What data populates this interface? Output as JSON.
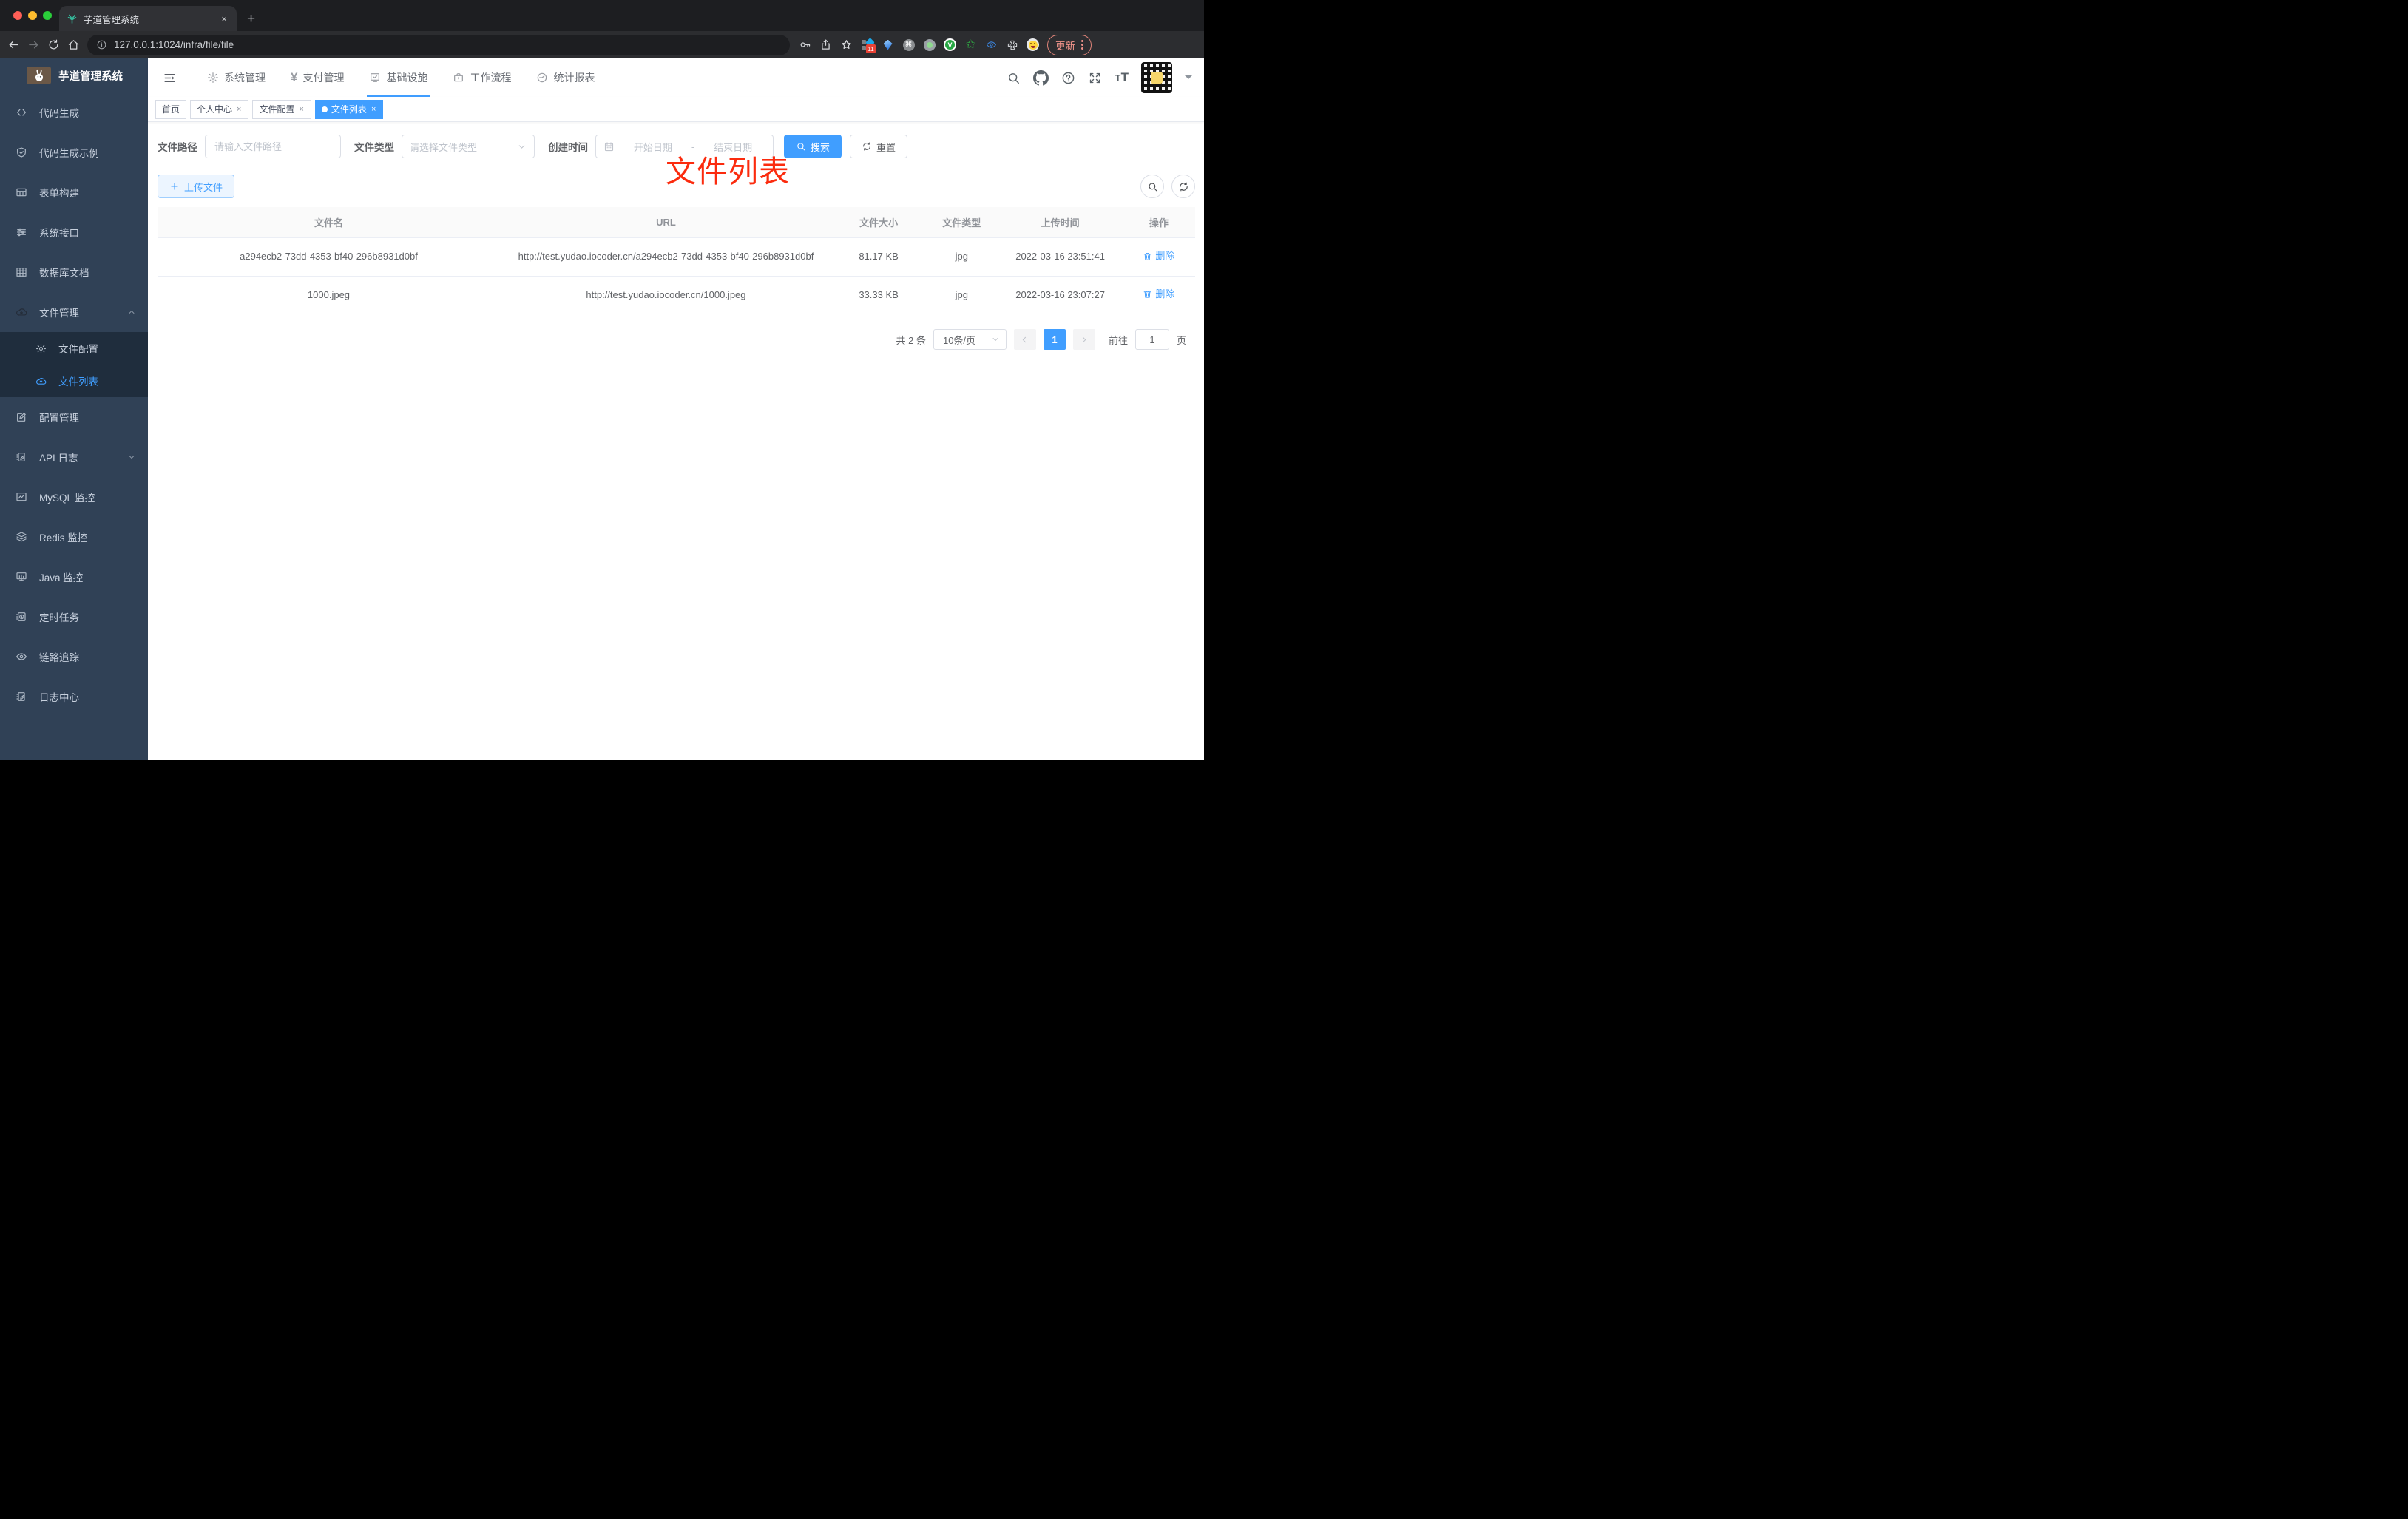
{
  "browser": {
    "tab_title": "芋道管理系统",
    "close_tab": "×",
    "new_tab": "+",
    "url": "127.0.0.1:1024/infra/file/file",
    "extension_badge": "11",
    "v_letter": "V",
    "cmd_glyph": "⌘",
    "star_glyph": "✩",
    "update_label": "更新"
  },
  "sidebar": {
    "title": "芋道管理系统",
    "items": [
      {
        "label": "代码生成",
        "icon": "code-icon"
      },
      {
        "label": "代码生成示例",
        "icon": "shield-icon"
      },
      {
        "label": "表单构建",
        "icon": "form-icon"
      },
      {
        "label": "系统接口",
        "icon": "sliders-icon"
      },
      {
        "label": "数据库文档",
        "icon": "grid-icon"
      },
      {
        "label": "文件管理",
        "icon": "cloud-download-icon",
        "state": "expanded"
      },
      {
        "label": "配置管理",
        "icon": "edit-icon"
      },
      {
        "label": "API 日志",
        "icon": "log-pen-icon",
        "state": "collapsed"
      },
      {
        "label": "MySQL 监控",
        "icon": "chart-icon"
      },
      {
        "label": "Redis 监控",
        "icon": "layers-icon"
      },
      {
        "label": "Java 监控",
        "icon": "monitor-icon"
      },
      {
        "label": "定时任务",
        "icon": "timer-icon"
      },
      {
        "label": "链路追踪",
        "icon": "eye-icon"
      },
      {
        "label": "日志中心",
        "icon": "log-pen-icon"
      }
    ],
    "submenu": [
      {
        "label": "文件配置",
        "icon": "gear-icon"
      },
      {
        "label": "文件列表",
        "icon": "cloud-upload-icon",
        "active": true
      }
    ]
  },
  "topnav": {
    "yen_glyph": "¥",
    "items": [
      {
        "label": "系统管理",
        "icon": "gear-icon"
      },
      {
        "label": "支付管理",
        "icon": "yen-icon"
      },
      {
        "label": "基础设施",
        "icon": "infra-icon",
        "active": true
      },
      {
        "label": "工作流程",
        "icon": "briefcase-icon"
      },
      {
        "label": "统计报表",
        "icon": "dashboard-icon"
      }
    ],
    "font_size_glyph": "тT"
  },
  "tags": [
    {
      "label": "首页",
      "closable": false
    },
    {
      "label": "个人中心",
      "closable": true
    },
    {
      "label": "文件配置",
      "closable": true
    },
    {
      "label": "文件列表",
      "closable": true,
      "active": true
    }
  ],
  "tag_close_glyph": "×",
  "annotation": "文件列表",
  "filters": {
    "path_label": "文件路径",
    "path_placeholder": "请输入文件路径",
    "type_label": "文件类型",
    "type_placeholder": "请选择文件类型",
    "date_label": "创建时间",
    "date_start_placeholder": "开始日期",
    "date_separator": "-",
    "date_end_placeholder": "结束日期",
    "search_label": "搜索",
    "reset_label": "重置"
  },
  "toolbar": {
    "upload_label": "上传文件"
  },
  "table": {
    "columns": [
      "文件名",
      "URL",
      "文件大小",
      "文件类型",
      "上传时间",
      "操作"
    ],
    "rows": [
      {
        "name": "a294ecb2-73dd-4353-bf40-296b8931d0bf",
        "url": "http://test.yudao.iocoder.cn/a294ecb2-73dd-4353-bf40-296b8931d0bf",
        "size": "81.17 KB",
        "type": "jpg",
        "time": "2022-03-16 23:51:41",
        "action": "删除"
      },
      {
        "name": "1000.jpeg",
        "url": "http://test.yudao.iocoder.cn/1000.jpeg",
        "size": "33.33 KB",
        "type": "jpg",
        "time": "2022-03-16 23:07:27",
        "action": "删除"
      }
    ]
  },
  "pagination": {
    "total": "共 2 条",
    "page_size": "10条/页",
    "current_page": "1",
    "goto_label": "前往",
    "goto_value": "1",
    "page_unit": "页"
  },
  "colors": {
    "accent_blue": "#409eff",
    "sidebar_bg": "#304156",
    "submenu_bg": "#1f2d3d",
    "annotation_red": "#fb2b0e"
  }
}
